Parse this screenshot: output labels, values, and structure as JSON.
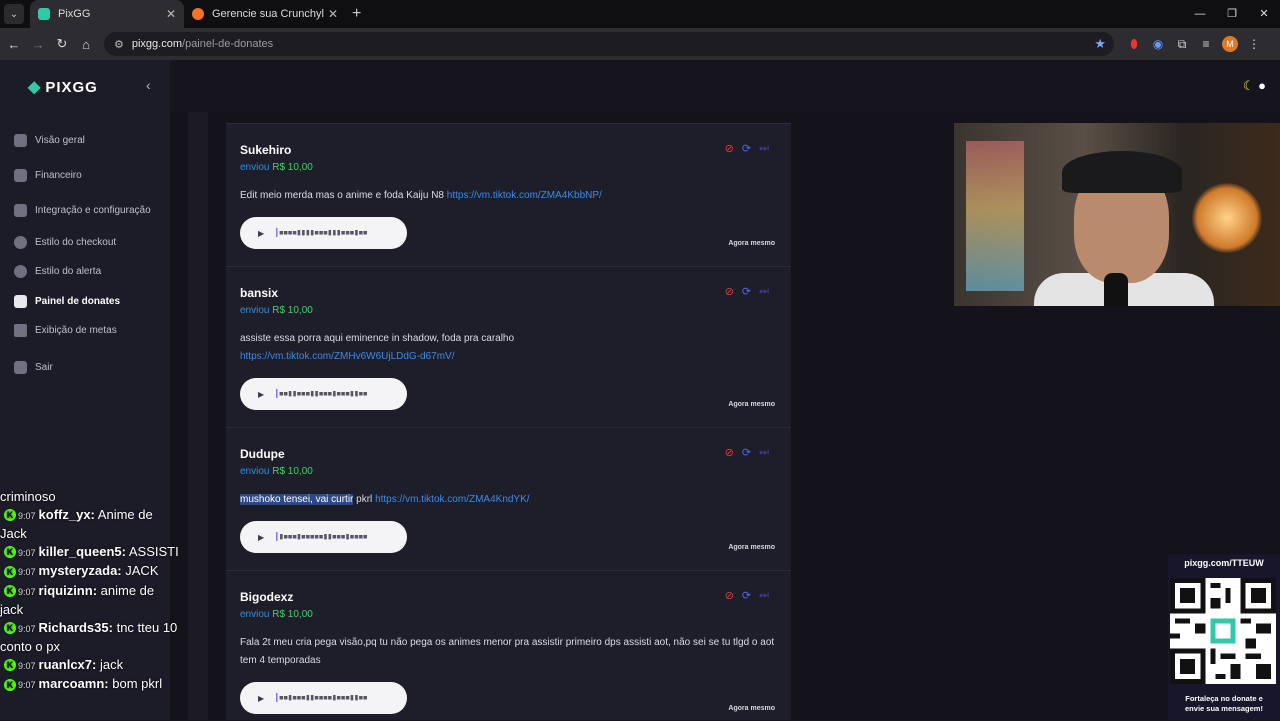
{
  "browser": {
    "tabs": [
      {
        "title": "PixGG",
        "active": true
      },
      {
        "title": "Gerencie sua Crunchylista | Cru",
        "active": false
      }
    ],
    "new_tab": "+",
    "url_host": "pixgg.com",
    "url_path": "/painel-de-donates",
    "profile_initial": "M"
  },
  "sidebar": {
    "logo": "PIXGG",
    "items": [
      {
        "label": "Visão geral",
        "icon": "home-icon"
      },
      {
        "label": "Financeiro",
        "icon": "wallet-icon"
      },
      {
        "label": "Integração e configuração",
        "icon": "settings-icon"
      },
      {
        "label": "Estilo do checkout",
        "icon": "palette-icon"
      },
      {
        "label": "Estilo do alerta",
        "icon": "palette-icon"
      },
      {
        "label": "Painel de donates",
        "icon": "chart-icon",
        "active": true
      },
      {
        "label": "Exibição de metas",
        "icon": "star-icon"
      },
      {
        "label": "Sair",
        "icon": "logout-icon"
      }
    ]
  },
  "donations": [
    {
      "name": "Sukehiro",
      "sent_label": "enviou",
      "amount": "R$ 10,00",
      "message": "Edit meio merda mas o anime e foda Kaiju N8 ",
      "link": "https://vm.tiktok.com/ZMA4KbbNP/",
      "time": "Agora mesmo"
    },
    {
      "name": "bansix",
      "sent_label": "enviou",
      "amount": "R$ 10,00",
      "message": "assiste essa porra aqui eminence in shadow, foda pra caralho",
      "link": "https://vm.tiktok.com/ZMHv6W6UjLDdG-d67mV/",
      "time": "Agora mesmo"
    },
    {
      "name": "Dudupe",
      "sent_label": "enviou",
      "amount": "R$ 10,00",
      "message_highlight": "mushoko tensei, vai curtir",
      "message": " pkrl ",
      "link": "https://vm.tiktok.com/ZMA4KndYK/",
      "time": "Agora mesmo"
    },
    {
      "name": "Bigodexz",
      "sent_label": "enviou",
      "amount": "R$ 10,00",
      "message": "Fala 2t meu cria pega visão,pq tu não pega os animes menor pra assistir primeiro dps assisti aot, não sei se tu tlgd o aot tem 4 temporadas",
      "time": "Agora mesmo"
    }
  ],
  "chat": [
    {
      "time": "",
      "user": "",
      "text": "criminoso"
    },
    {
      "time": "9:07",
      "user": "koffz_yx:",
      "text": "Anime de Jack"
    },
    {
      "time": "9:07",
      "user": "killer_queen5:",
      "text": "ASSISTI"
    },
    {
      "time": "9:07",
      "user": "mysteryzada:",
      "text": "JACK"
    },
    {
      "time": "9:07",
      "user": "riquizinn:",
      "text": "anime de jack"
    },
    {
      "time": "9:07",
      "user": "Richards35:",
      "text": "tnc tteu 10 conto o px"
    },
    {
      "time": "9:07",
      "user": "ruanlcx7:",
      "text": "jack"
    },
    {
      "time": "9:07",
      "user": "marcoamn:",
      "text": "bom pkrl"
    }
  ],
  "qr": {
    "title": "pixgg.com/TTEUW",
    "caption_line1": "Fortaleça no donate e",
    "caption_line2": "envie sua mensagem!"
  },
  "colors": {
    "accent_green": "#45d06b",
    "link_blue": "#3b8bea",
    "logo_teal": "#32c9a8",
    "block_red": "#e23a3a"
  }
}
